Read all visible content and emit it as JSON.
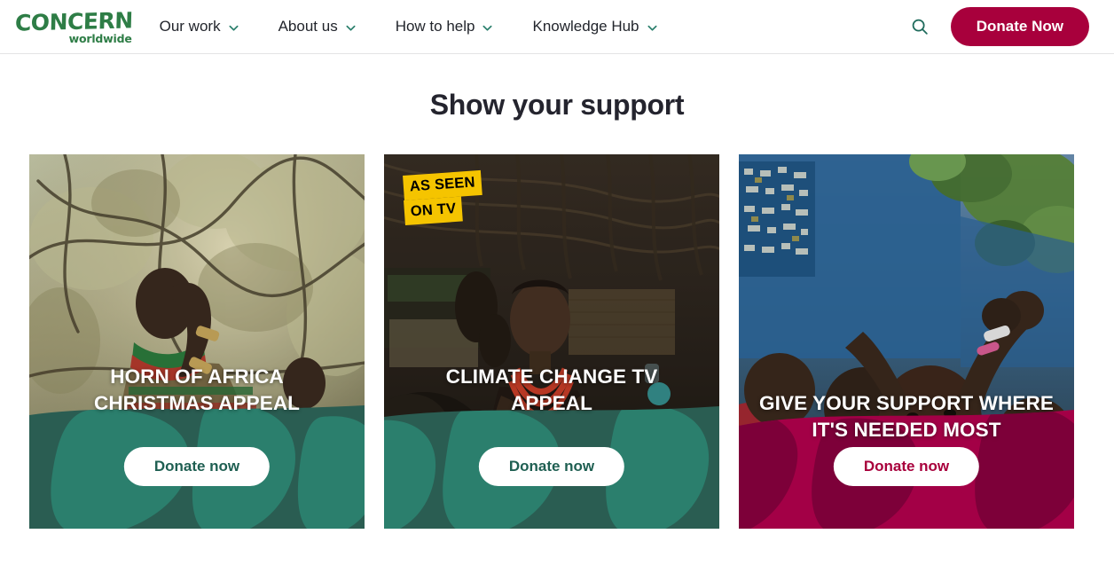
{
  "header": {
    "logo": {
      "main": "CONCERN",
      "sub": "worldwide",
      "color": "#2e7d46"
    },
    "nav": [
      {
        "label": "Our work",
        "icon": "chevron-down-icon"
      },
      {
        "label": "About us",
        "icon": "chevron-down-icon"
      },
      {
        "label": "How to help",
        "icon": "chevron-down-icon"
      },
      {
        "label": "Knowledge Hub",
        "icon": "chevron-down-icon"
      }
    ],
    "search_icon": "search-icon",
    "donate_label": "Donate Now",
    "donate_color": "#a8003c"
  },
  "main": {
    "title": "Show your support",
    "cards": [
      {
        "title": "HORN OF AFRICA CHRISTMAS APPEAL",
        "cta": "Donate now",
        "footer_color": "#2a5d52",
        "footer_accent": "#2b7f6d",
        "cta_color": "#1f5f52",
        "badge": null,
        "image_alt": "Woman in striped shawl and child standing among dry trees"
      },
      {
        "title": "CLIMATE CHANGE TV APPEAL",
        "cta": "Donate now",
        "footer_color": "#2a5d52",
        "footer_accent": "#2b7f6d",
        "cta_color": "#1f5f52",
        "badge": {
          "line1": "AS SEEN",
          "line2": "ON TV",
          "bg": "#f5c400",
          "fg": "#000000"
        },
        "image_alt": "Woman with red beaded necklace seated inside a hut with a baby"
      },
      {
        "title": "GIVE YOUR SUPPORT WHERE IT'S NEEDED MOST",
        "cta": "Donate now",
        "footer_color": "#a30046",
        "footer_accent": "#7d0039",
        "cta_color": "#a8003c",
        "badge": null,
        "image_alt": "Smiling children with arms raised outdoors"
      }
    ]
  }
}
